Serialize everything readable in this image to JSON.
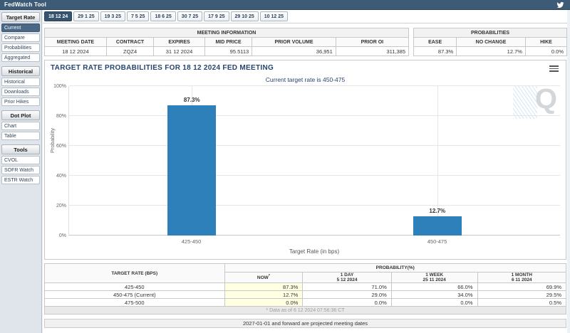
{
  "app": {
    "title": "FedWatch Tool"
  },
  "tabs": [
    "18 12 24",
    "29 1 25",
    "19 3 25",
    "7 5 25",
    "18 6 25",
    "30 7 25",
    "17 9 25",
    "29 10 25",
    "10 12 25"
  ],
  "sidebar": {
    "sections": [
      {
        "header": "Target Rate",
        "items": [
          "Current",
          "Compare",
          "Probabilities",
          "Aggregated"
        ]
      },
      {
        "header": "Historical",
        "items": [
          "Historical",
          "Downloads",
          "Prior Hikes"
        ]
      },
      {
        "header": "Dot Plot",
        "items": [
          "Chart",
          "Table"
        ]
      },
      {
        "header": "Tools",
        "items": [
          "CVOL",
          "SOFR Watch",
          "ESTR Watch"
        ]
      }
    ]
  },
  "meeting_info": {
    "title": "MEETING INFORMATION",
    "columns": [
      "MEETING DATE",
      "CONTRACT",
      "EXPIRES",
      "MID PRICE",
      "PRIOR VOLUME",
      "PRIOR OI"
    ],
    "values": [
      "18 12 2024",
      "ZQZ4",
      "31 12 2024",
      "95.5113",
      "36,951",
      "311,385"
    ]
  },
  "probabilities_box": {
    "title": "PROBABILITIES",
    "columns": [
      "EASE",
      "NO CHANGE",
      "HIKE"
    ],
    "values": [
      "87.3%",
      "12.7%",
      "0.0%"
    ]
  },
  "chart_data": {
    "type": "bar",
    "title": "TARGET RATE PROBABILITIES FOR 18 12 2024 FED MEETING",
    "subtitle": "Current target rate is 450-475",
    "categories": [
      "425-450",
      "450-475"
    ],
    "values": [
      87.3,
      12.7
    ],
    "value_labels": [
      "87.3%",
      "12.7%"
    ],
    "xlabel": "Target Rate (in bps)",
    "ylabel": "Probability",
    "ylim": [
      0,
      100
    ],
    "yticks": [
      "0%",
      "20%",
      "40%",
      "60%",
      "80%",
      "100%"
    ],
    "grid": true,
    "legend": false,
    "bar_color": "#2d80b9",
    "watermark": "Q"
  },
  "bottom_table": {
    "col_group_left": "TARGET RATE (BPS)",
    "col_group_right": "PROBABILITY(%)",
    "now_label": "NOW",
    "now_sup": "*",
    "columns": [
      {
        "l1": "1 DAY",
        "l2": "5 12 2024"
      },
      {
        "l1": "1 WEEK",
        "l2": "25 11 2024"
      },
      {
        "l1": "1 MONTH",
        "l2": "6 11 2024"
      }
    ],
    "rows": [
      {
        "label": "425-450",
        "now": "87.3%",
        "day": "71.0%",
        "week": "66.0%",
        "month": "69.9%"
      },
      {
        "label": "450-475 (Current)",
        "now": "12.7%",
        "day": "29.0%",
        "week": "34.0%",
        "month": "29.5%"
      },
      {
        "label": "475-500",
        "now": "0.0%",
        "day": "0.0%",
        "week": "0.0%",
        "month": "0.5%"
      }
    ],
    "footnote": "* Data as of 6 12 2024 07:56:36 CT",
    "note": "2027-01-01 and forward are projected meeting dates"
  },
  "colors": {
    "topbar": "#3d5a77",
    "selected_tab": "#36536f",
    "selected_sidebar": "#4a6785",
    "bar": "#2d80b9",
    "now_cell": "#ffffe1",
    "title_navy": "#26456e"
  }
}
